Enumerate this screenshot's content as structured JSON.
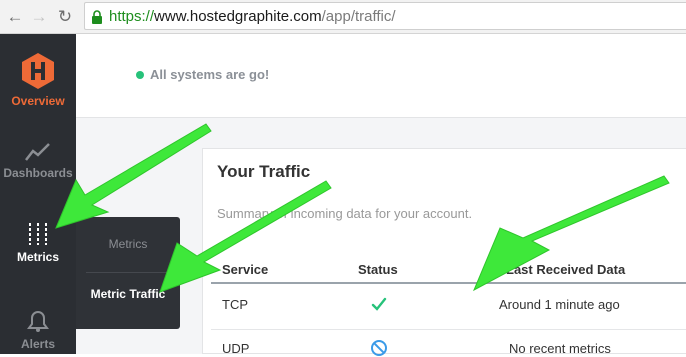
{
  "browser": {
    "url_scheme": "https://",
    "url_host": "www.hostedgraphite.com",
    "url_path": "/app/traffic/"
  },
  "sidebar": {
    "logo_label": "Overview",
    "items": [
      {
        "label": "Dashboards",
        "icon": "line-chart-icon"
      },
      {
        "label": "Metrics",
        "icon": "sliders-icon"
      },
      {
        "label": "Alerts",
        "icon": "bell-icon"
      }
    ],
    "accent_color": "#ee6a37"
  },
  "submenu": {
    "items": [
      {
        "label": "Metrics"
      },
      {
        "label": "Metric Traffic"
      }
    ]
  },
  "status": {
    "text": "All systems are go!",
    "color": "#27c27a"
  },
  "traffic": {
    "title": "Your Traffic",
    "subtitle": "Summary of incoming data for your account.",
    "columns": [
      "Service",
      "Status",
      "Last Received Data"
    ],
    "rows": [
      {
        "service": "TCP",
        "status_icon": "check-icon",
        "last": "Around 1 minute ago"
      },
      {
        "service": "UDP",
        "status_icon": "blocked-icon",
        "last": "No recent metrics"
      }
    ]
  }
}
